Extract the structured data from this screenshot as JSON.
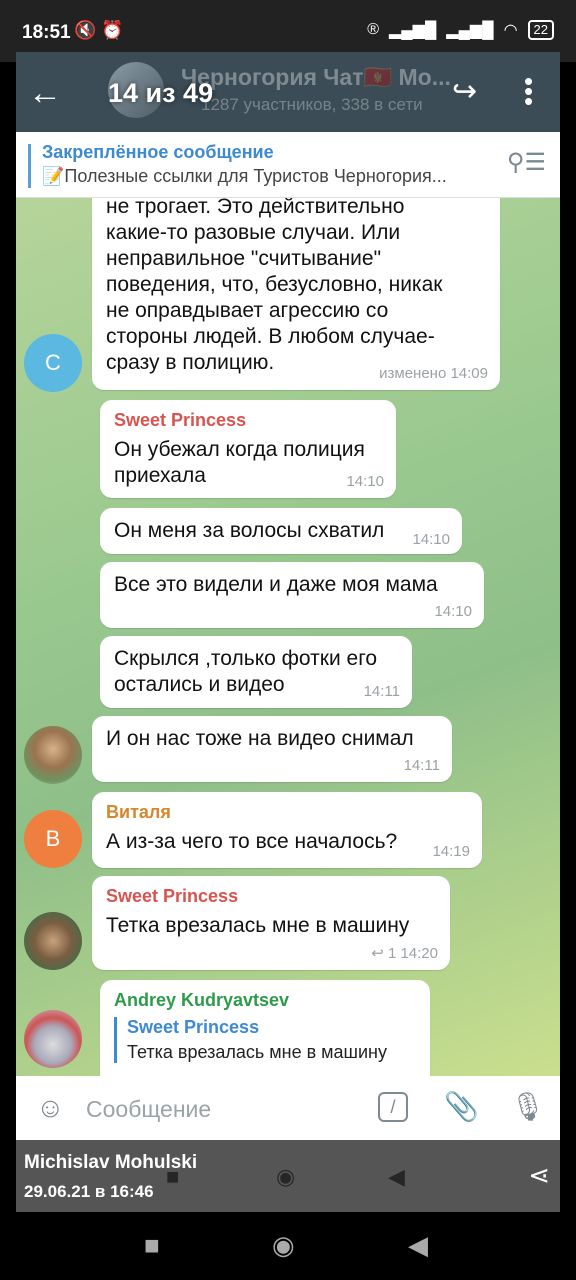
{
  "status": {
    "time": "18:51",
    "icons_left": "🔇 ⏰",
    "battery": "22"
  },
  "header": {
    "counter": "14 из 49",
    "title": "Черногория Чат🇲🇪 Мо...",
    "subtitle": "1287 участников, 338 в сети"
  },
  "pinned": {
    "title": "Закреплённое сообщение",
    "text": "📝Полезные ссылки для Туристов   Черногория..."
  },
  "messages": [
    {
      "text": "не трогает. Это действительно\nкакие-то разовые случаи. Или\nнеправильное \"считывание\"\nповедения, что, безусловно, никак\nне оправдывает агрессию со\nстороны людей. В любом случае-\nсразу в полицию.",
      "meta": "изменено 14:09",
      "avatar": "C"
    },
    {
      "sender": "Sweet Princess",
      "text": "Он убежал когда полиция\nприехала",
      "meta": "14:10"
    },
    {
      "text": "Он меня за волосы схватил",
      "meta": "14:10"
    },
    {
      "text": "Все это видели и даже моя мама",
      "meta": "14:10"
    },
    {
      "text": "Скрылся ,только фотки его\nостались и видео",
      "meta": "14:11"
    },
    {
      "text": "И он нас тоже на видео снимал",
      "meta": "14:11"
    },
    {
      "sender": "Виталя",
      "text": "А из-за чего то все началось?",
      "meta": "14:19",
      "avatar": "В"
    },
    {
      "sender": "Sweet Princess",
      "text": "Тетка врезалась мне в машину",
      "meta": "↩ 1  14:20"
    },
    {
      "sender": "Andrey Kudryavtsev",
      "reply_name": "Sweet Princess",
      "reply_text": "Тетка врезалась мне в машину"
    }
  ],
  "input": {
    "placeholder": "Сообщение",
    "cmd": "/"
  },
  "author": {
    "name": "Michislav Mohulski",
    "date": "29.06.21 в 16:46"
  },
  "colors": {
    "sender_sweet": "#d9534f",
    "sender_vitalya": "#d8862b",
    "sender_andrey": "#2e9b4a",
    "avatar_c": "#5bb8e0",
    "avatar_v": "#ef7f3e"
  }
}
